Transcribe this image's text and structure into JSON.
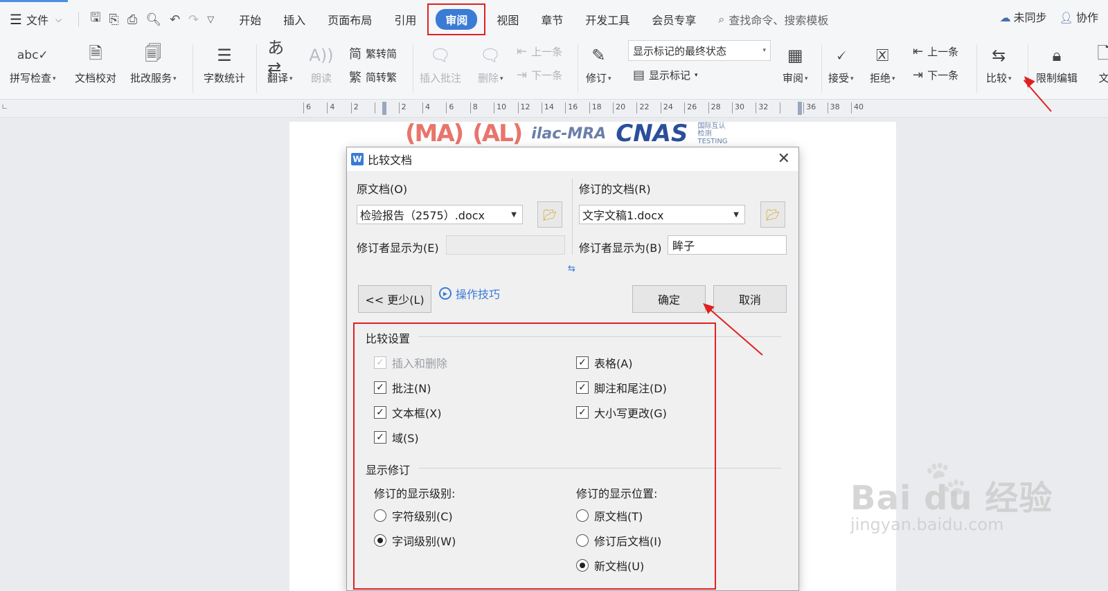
{
  "menubar": {
    "file_label": "文件",
    "tabs": [
      "开始",
      "插入",
      "页面布局",
      "引用",
      "审阅",
      "视图",
      "章节",
      "开发工具",
      "会员专享"
    ],
    "active_tab": "审阅",
    "search_text": "查找命令、搜索模板",
    "sync_label": "未同步",
    "collab_label": "协作"
  },
  "ribbon": {
    "spell_check": "拼写检查",
    "doc_proof": "文档校对",
    "correction_service": "批改服务",
    "word_count": "字数统计",
    "translate": "翻译",
    "read_aloud": "朗读",
    "trad_to_simp": "繁转简",
    "simp_to_trad": "简转繁",
    "insert_comment": "插入批注",
    "delete": "删除",
    "prev_comment": "上一条",
    "next_comment": "下一条",
    "track_changes": "修订",
    "markup_state": "显示标记的最终状态",
    "show_markup": "显示标记",
    "review": "审阅",
    "accept": "接受",
    "reject": "拒绝",
    "prev_change": "上一条",
    "next_change": "下一条",
    "compare": "比较",
    "restrict_edit": "限制编辑",
    "doc_more": "文"
  },
  "ruler": {
    "ticks": [
      "6",
      "4",
      "2",
      "",
      "2",
      "4",
      "6",
      "8",
      "10",
      "12",
      "14",
      "16",
      "18",
      "20",
      "22",
      "24",
      "26",
      "28",
      "30",
      "32",
      "",
      "36",
      "38",
      "40"
    ]
  },
  "document": {
    "logo_ma": "(MA)",
    "logo_cal": "(AL)",
    "logo_ilac": "ilac-MRA",
    "logo_cnas": "CNAS",
    "logo_small1": "国际互认",
    "logo_small2": "检测",
    "logo_small3": "TESTING"
  },
  "dialog": {
    "title": "比较文档",
    "original_label": "原文档(O)",
    "original_value": "检验报告（2575）.docx",
    "revised_label": "修订的文档(R)",
    "revised_value": "文字文稿1.docx",
    "orig_author_label": "修订者显示为(E)",
    "orig_author_value": "",
    "rev_author_label": "修订者显示为(B)",
    "rev_author_value": "眸子",
    "less_button": "<< 更少(L)",
    "tips_link": "操作技巧",
    "ok_button": "确定",
    "cancel_button": "取消",
    "compare_settings_title": "比较设置",
    "checkboxes": [
      {
        "label": "插入和删除",
        "checked": true,
        "disabled": true
      },
      {
        "label": "表格(A)",
        "checked": true,
        "disabled": false
      },
      {
        "label": "批注(N)",
        "checked": true,
        "disabled": false
      },
      {
        "label": "脚注和尾注(D)",
        "checked": true,
        "disabled": false
      },
      {
        "label": "文本框(X)",
        "checked": true,
        "disabled": false
      },
      {
        "label": "大小写更改(G)",
        "checked": true,
        "disabled": false
      },
      {
        "label": "域(S)",
        "checked": true,
        "disabled": false
      }
    ],
    "show_changes_title": "显示修订",
    "level_label": "修订的显示级别:",
    "level_options": [
      {
        "label": "字符级别(C)",
        "selected": false
      },
      {
        "label": "字词级别(W)",
        "selected": true
      }
    ],
    "position_label": "修订的显示位置:",
    "position_options": [
      {
        "label": "原文档(T)",
        "selected": false
      },
      {
        "label": "修订后文档(I)",
        "selected": false
      },
      {
        "label": "新文档(U)",
        "selected": true
      }
    ]
  },
  "watermark": {
    "brand": "Bai du 经验",
    "url": "jingyan.baidu.com"
  },
  "colors": {
    "accent": "#3a7bd5",
    "highlight": "#e02020"
  }
}
